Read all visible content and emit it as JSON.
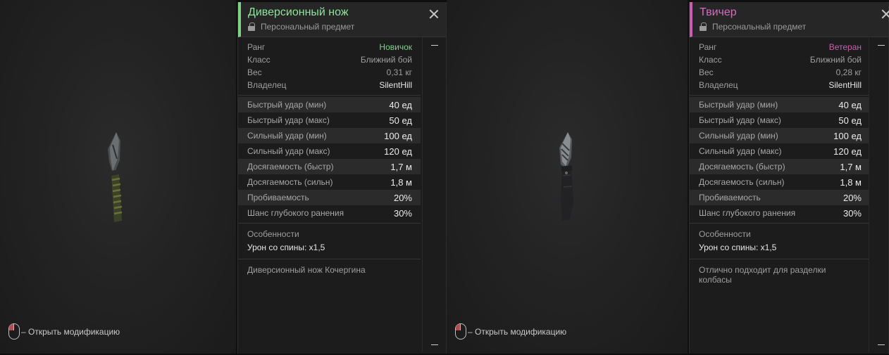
{
  "panels": [
    {
      "hint": "– Открыть модификацию",
      "title": "Диверсионный нож",
      "subtitle": "Персональный предмет",
      "accent": "#7fd18a",
      "info": [
        {
          "label": "Ранг",
          "value": "Новичок"
        },
        {
          "label": "Класс",
          "value": "Ближний бой"
        },
        {
          "label": "Вес",
          "value": "0,31 кг"
        },
        {
          "label": "Владелец",
          "value": "SilentHill"
        }
      ],
      "stats": [
        {
          "label": "Быстрый удар (мин)",
          "value": "40 ед"
        },
        {
          "label": "Быстрый удар (макс)",
          "value": "50 ед"
        },
        {
          "label": "Сильный удар (мин)",
          "value": "100 ед"
        },
        {
          "label": "Сильный удар (макс)",
          "value": "120 ед"
        },
        {
          "label": "Досягаемость (быстр)",
          "value": "1,7 м"
        },
        {
          "label": "Досягаемость (сильн)",
          "value": "1,8 м"
        },
        {
          "label": "Пробиваемость",
          "value": "20%"
        },
        {
          "label": "Шанс глубокого ранения",
          "value": "30%"
        }
      ],
      "features_title": "Особенности",
      "features_value": "Урон со спины: x1,5",
      "description": "Диверсионный нож Кочергина"
    },
    {
      "hint": "– Открыть модификацию",
      "title": "Твичер",
      "subtitle": "Персональный предмет",
      "accent": "#c65fae",
      "info": [
        {
          "label": "Ранг",
          "value": "Ветеран"
        },
        {
          "label": "Класс",
          "value": "Ближний бой"
        },
        {
          "label": "Вес",
          "value": "0,28 кг"
        },
        {
          "label": "Владелец",
          "value": "SilentHill"
        }
      ],
      "stats": [
        {
          "label": "Быстрый удар (мин)",
          "value": "40 ед"
        },
        {
          "label": "Быстрый удар (макс)",
          "value": "50 ед"
        },
        {
          "label": "Сильный удар (мин)",
          "value": "100 ед"
        },
        {
          "label": "Сильный удар (макс)",
          "value": "120 ед"
        },
        {
          "label": "Досягаемость (быстр)",
          "value": "1,7 м"
        },
        {
          "label": "Досягаемость (сильн)",
          "value": "1,8 м"
        },
        {
          "label": "Пробиваемость",
          "value": "20%"
        },
        {
          "label": "Шанс глубокого ранения",
          "value": "30%"
        }
      ],
      "features_title": "Особенности",
      "features_value": "Урон со спины: x1,5",
      "description": "Отлично подходит для разделки колбасы"
    }
  ],
  "icons": {
    "mouse": "mouse-icon",
    "lock": "lock-icon",
    "close": "close-icon",
    "scroll_up": "scroll-up-icon",
    "scroll_down": "scroll-down-icon"
  }
}
